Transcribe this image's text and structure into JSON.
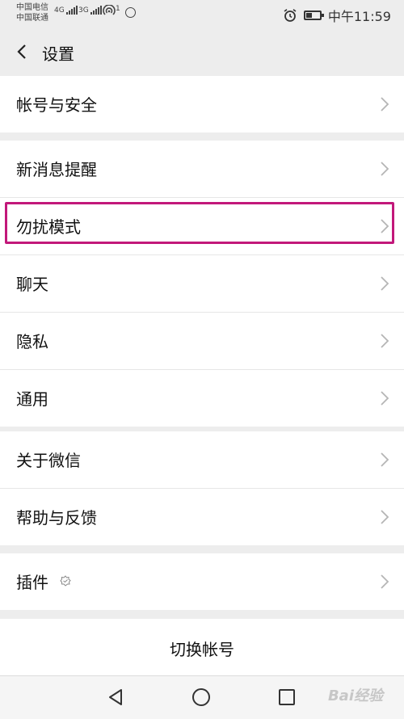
{
  "statusbar": {
    "carrier1": "中国电信",
    "carrier2": "中国联通",
    "net1": "4G",
    "net2": "3G",
    "hotspot_count": "1",
    "time": "中午11:59"
  },
  "header": {
    "title": "设置"
  },
  "groups": [
    {
      "items": [
        {
          "label": "帐号与安全"
        }
      ]
    },
    {
      "items": [
        {
          "label": "新消息提醒"
        },
        {
          "label": "勿扰模式"
        },
        {
          "label": "聊天"
        },
        {
          "label": "隐私"
        },
        {
          "label": "通用"
        }
      ]
    },
    {
      "items": [
        {
          "label": "关于微信"
        },
        {
          "label": "帮助与反馈"
        }
      ]
    },
    {
      "items": [
        {
          "label": "插件"
        }
      ]
    }
  ],
  "switch_account": "切换帐号",
  "watermark": "Bai经验",
  "colors": {
    "highlight": "#c2187a",
    "background": "#ededed"
  }
}
